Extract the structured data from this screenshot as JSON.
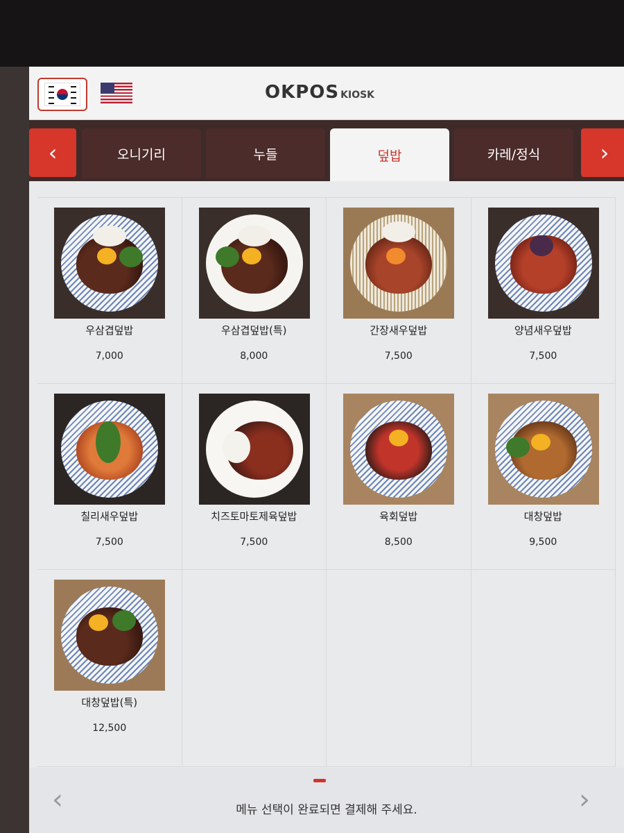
{
  "header": {
    "logo_main": "OKPOS",
    "logo_sub": "KIOSK",
    "languages": [
      "korean-flag-icon",
      "us-flag-icon"
    ]
  },
  "categories": {
    "tabs": [
      {
        "label": "오니기리"
      },
      {
        "label": "누들"
      },
      {
        "label": "덮밥",
        "active": true
      },
      {
        "label": "카레/정식"
      }
    ],
    "prev_label": "‹",
    "next_label": "›"
  },
  "menu": [
    {
      "name": "우삼겹덮밥",
      "price": "7,000"
    },
    {
      "name": "우삼겹덮밥(특)",
      "price": "8,000"
    },
    {
      "name": "간장새우덮밥",
      "price": "7,500"
    },
    {
      "name": "양념새우덮밥",
      "price": "7,500"
    },
    {
      "name": "칠리새우덮밥",
      "price": "7,500"
    },
    {
      "name": "치즈토마토제육덮밥",
      "price": "7,500"
    },
    {
      "name": "육회덮밥",
      "price": "8,500"
    },
    {
      "name": "대창덮밥",
      "price": "9,500"
    },
    {
      "name": "대창덮밥(특)",
      "price": "12,500"
    }
  ],
  "footer": {
    "prev_page": "‹",
    "next_page": "›",
    "guide_text": "메뉴 선택이 완료되면 결제해 주세요."
  },
  "colors": {
    "accent": "#d0342a",
    "tab_bg": "#4b2c2b",
    "strip_bg": "#3e2a29"
  }
}
